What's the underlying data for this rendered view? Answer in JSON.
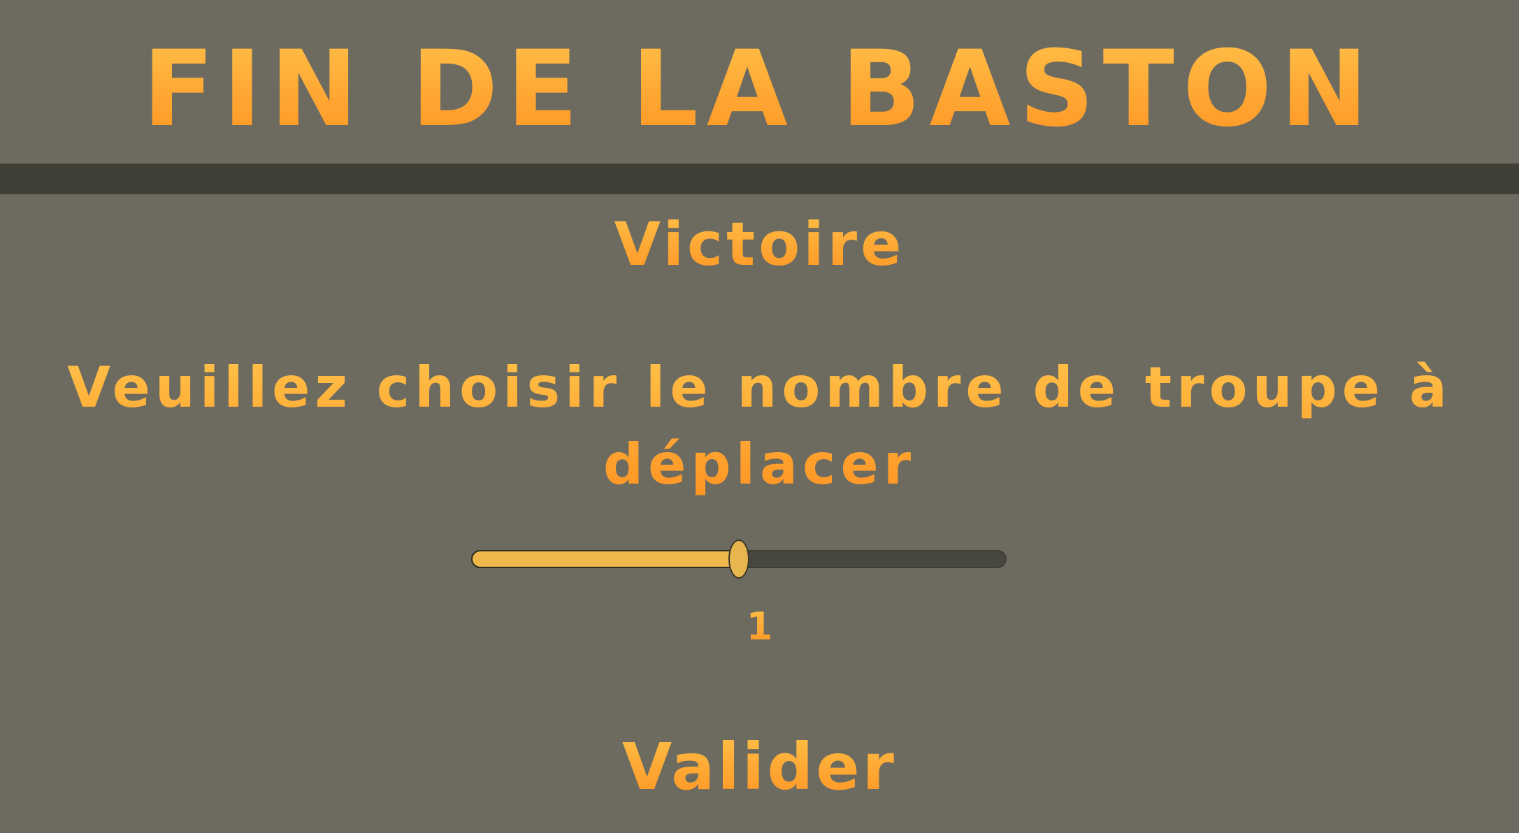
{
  "header": {
    "title": "FIN DE LA BASTON"
  },
  "result": {
    "label": "Victoire"
  },
  "troop_selection": {
    "prompt": "Veuillez choisir le nombre de troupe à déplacer",
    "slider": {
      "value_fraction": 0.5,
      "value_label": "1"
    }
  },
  "actions": {
    "validate_label": "Valider"
  },
  "colors": {
    "background": "#6d6b5f",
    "divider": "#404036",
    "accent_text": "#ffa733",
    "slider_fill": "#efb84b",
    "slider_track": "#484840"
  }
}
